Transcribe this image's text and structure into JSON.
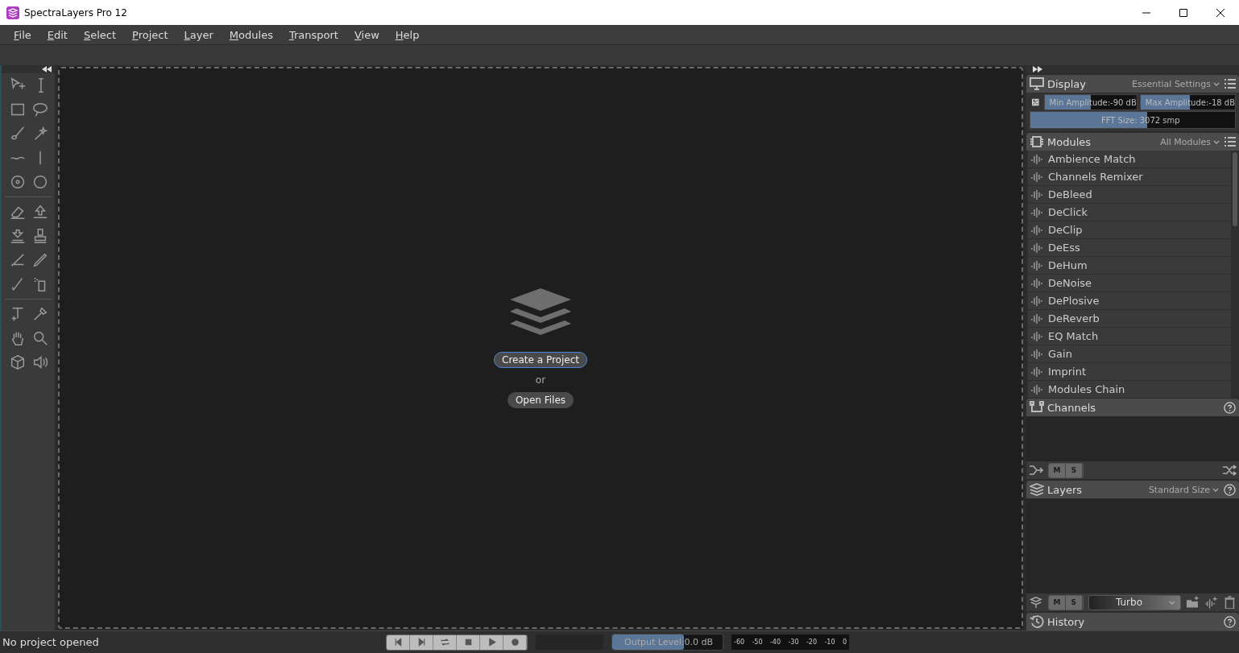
{
  "window": {
    "title": "SpectraLayers Pro 12"
  },
  "menu": [
    "File",
    "Edit",
    "Select",
    "Project",
    "Layer",
    "Modules",
    "Transport",
    "View",
    "Help"
  ],
  "start": {
    "create_button": "Create a Project",
    "or_text": "or",
    "open_button": "Open Files"
  },
  "display": {
    "title": "Display",
    "preset": "Essential Settings",
    "sliders": [
      {
        "label": "Min Amplitude:",
        "reading": "-90 dB",
        "level": 0.5
      },
      {
        "label": "Max Amplitude:",
        "reading": "-18 dB",
        "level": 0.52
      },
      {
        "label": "FFT Size:",
        "reading": "3072 smp",
        "level": 0.57
      }
    ]
  },
  "modules": {
    "title": "Modules",
    "filter": "All Modules",
    "items": [
      "Ambience Match",
      "Channels Remixer",
      "DeBleed",
      "DeClick",
      "DeClip",
      "DeEss",
      "DeHum",
      "DeNoise",
      "DePlosive",
      "DeReverb",
      "EQ Match",
      "Gain",
      "Imprint",
      "Modules Chain"
    ]
  },
  "channels": {
    "title": "Channels",
    "mute": "M",
    "solo": "S"
  },
  "layers": {
    "title": "Layers",
    "size": "Standard Size",
    "mute": "M",
    "solo": "S",
    "colormap": "Turbo"
  },
  "history": {
    "title": "History"
  },
  "status_bar": {
    "message": "No project opened",
    "output": {
      "label": "Output Level:",
      "reading": "0.0 dB",
      "level": 0.65
    },
    "meter_ticks": [
      "-60",
      "-50",
      "-40",
      "-30",
      "-20",
      "-10",
      "0"
    ]
  }
}
